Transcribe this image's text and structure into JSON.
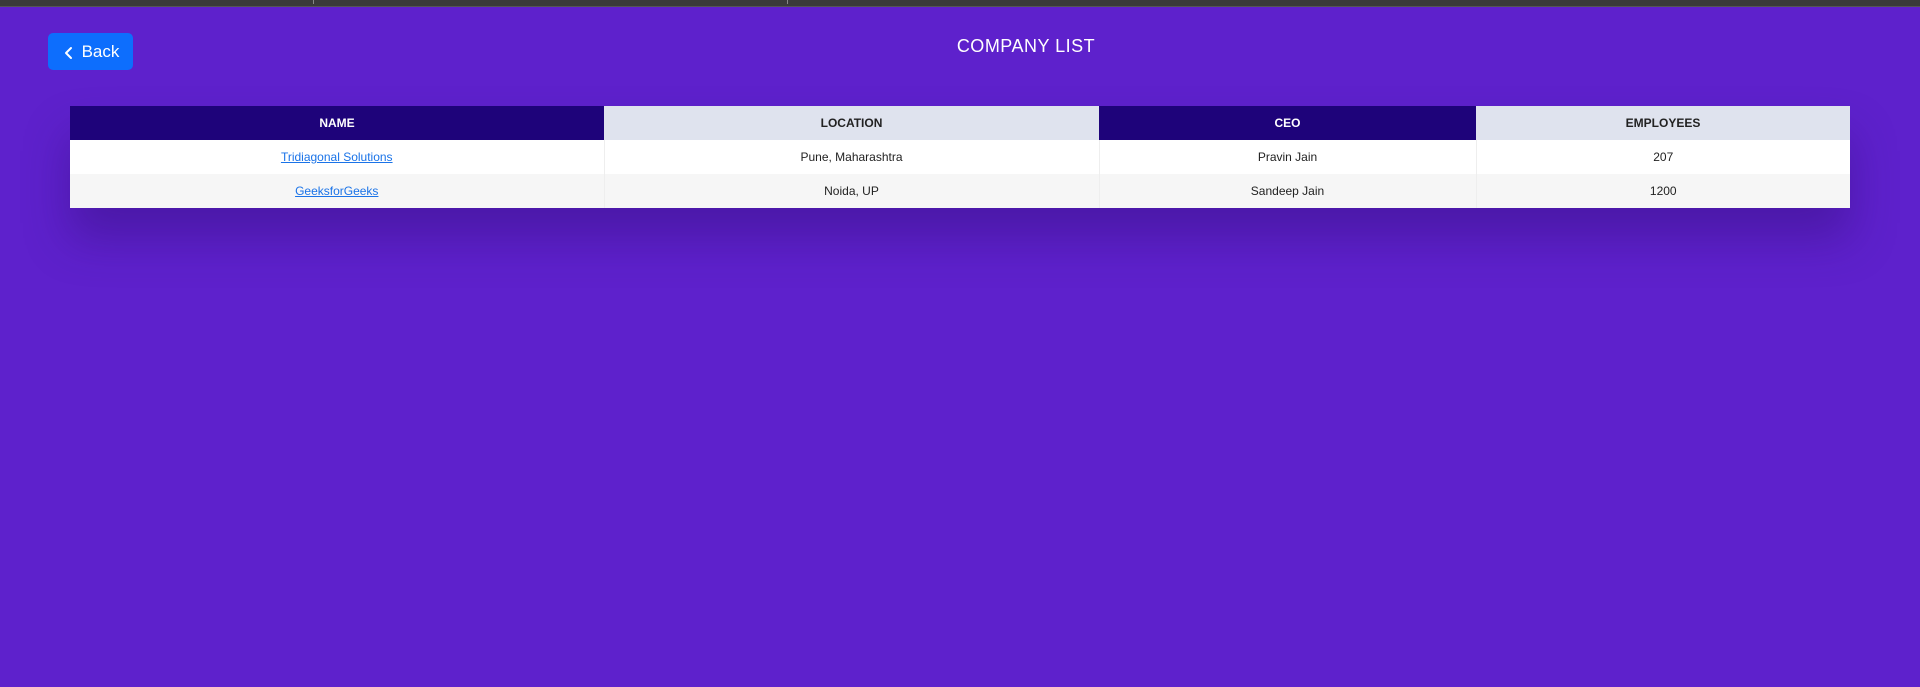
{
  "back_button": {
    "label": "Back",
    "icon": "chevron-left-icon"
  },
  "page": {
    "title": "COMPANY LIST"
  },
  "table": {
    "headers": [
      "NAME",
      "LOCATION",
      "CEO",
      "EMPLOYEES"
    ],
    "rows": [
      {
        "name": "Tridiagonal Solutions",
        "location": "Pune, Maharashtra",
        "ceo": "Pravin Jain",
        "employees": "207"
      },
      {
        "name": "GeeksforGeeks",
        "location": "Noida, UP",
        "ceo": "Sandeep Jain",
        "employees": "1200"
      }
    ]
  },
  "colors": {
    "background": "#5e21cc",
    "button": "#0d6efd",
    "header_dark": "#1e037a",
    "header_light": "#dfe3ee",
    "link": "#1a73e8"
  }
}
